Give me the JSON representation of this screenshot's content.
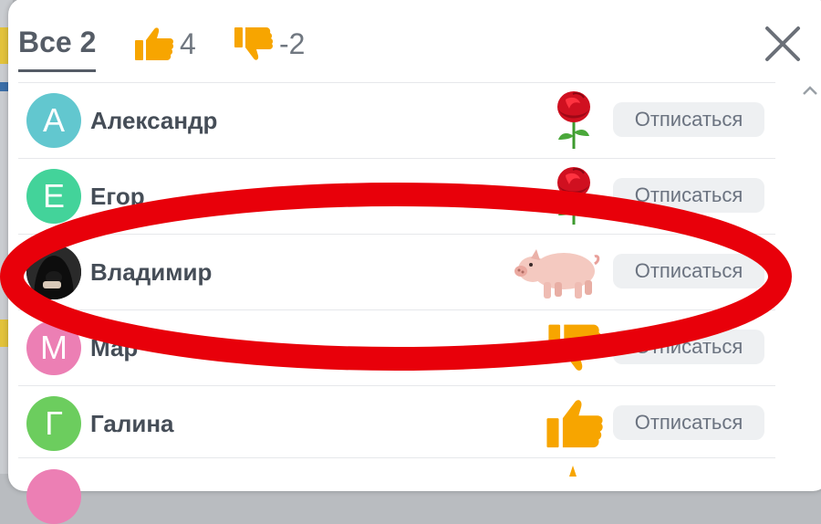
{
  "tabs": {
    "all": {
      "label": "Все 2"
    },
    "likes": {
      "count": "4",
      "icon": "thumbs-up-icon"
    },
    "dislikes": {
      "count": "-2",
      "icon": "thumbs-down-icon"
    }
  },
  "close_icon": "close-icon",
  "unsubscribe_label": "Отписаться",
  "colors": {
    "accent": "#f7a500",
    "underline": "#555c66",
    "highlight": "#e8000a"
  },
  "users": [
    {
      "initial": "А",
      "name": "Александр",
      "avatar_color": "#62c7cf",
      "reaction": "rose"
    },
    {
      "initial": "Е",
      "name": "Егор",
      "avatar_color": "#43d39a",
      "reaction": "rose"
    },
    {
      "initial": "",
      "name": "Владимир",
      "avatar_color": "#1b1b1b",
      "reaction": "pig"
    },
    {
      "initial": "М",
      "name": "Мар",
      "avatar_color": "#ec7fb4",
      "reaction": "thumbs-down"
    },
    {
      "initial": "Г",
      "name": "Галина",
      "avatar_color": "#6ccd5e",
      "reaction": "thumbs-up"
    }
  ]
}
